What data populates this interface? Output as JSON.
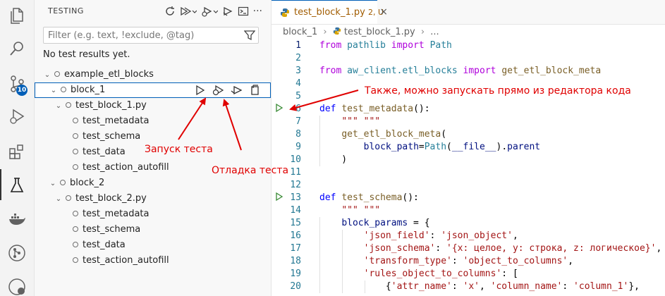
{
  "sidebar": {
    "title": "TESTING",
    "filter_placeholder": "Filter (e.g. text, !exclude, @tag)",
    "no_results": "No test results yet.",
    "tree": [
      {
        "label": "example_etl_blocks",
        "chev": "⌄"
      },
      {
        "label": "block_1",
        "chev": "⌄"
      },
      {
        "label": "test_block_1.py",
        "chev": "⌄"
      },
      {
        "label": "test_metadata",
        "chev": ""
      },
      {
        "label": "test_schema",
        "chev": ""
      },
      {
        "label": "test_data",
        "chev": ""
      },
      {
        "label": "test_action_autofill",
        "chev": ""
      },
      {
        "label": "block_2",
        "chev": "⌄"
      },
      {
        "label": "test_block_2.py",
        "chev": "⌄"
      },
      {
        "label": "test_metadata",
        "chev": ""
      },
      {
        "label": "test_schema",
        "chev": ""
      },
      {
        "label": "test_data",
        "chev": ""
      },
      {
        "label": "test_action_autofill",
        "chev": ""
      }
    ],
    "more_label": "···"
  },
  "activity": {
    "badge": "10",
    "icons": [
      "files-icon",
      "search-icon",
      "source-control-icon",
      "run-debug-icon",
      "extensions-icon",
      "testing-icon",
      "docker-icon",
      "git-graph-icon",
      "remote-icon"
    ]
  },
  "editor": {
    "tab_label": "test_block_1.py",
    "tab_status": "2, U",
    "breadcrumb": [
      "block_1",
      "test_block_1.py",
      "..."
    ],
    "lines": [
      {
        "n": "1",
        "segs": [
          [
            "kw2",
            "from"
          ],
          [
            "pl",
            " "
          ],
          [
            "cls",
            "pathlib"
          ],
          [
            "pl",
            " "
          ],
          [
            "kw2",
            "import"
          ],
          [
            "pl",
            " "
          ],
          [
            "cls",
            "Path"
          ]
        ]
      },
      {
        "n": "2",
        "segs": []
      },
      {
        "n": "3",
        "segs": [
          [
            "kw2",
            "from"
          ],
          [
            "pl",
            " "
          ],
          [
            "cls",
            "aw_client.etl_blocks"
          ],
          [
            "pl",
            " "
          ],
          [
            "kw2",
            "import"
          ],
          [
            "pl",
            " "
          ],
          [
            "fn",
            "get_etl_block_meta"
          ]
        ]
      },
      {
        "n": "4",
        "segs": []
      },
      {
        "n": "5",
        "segs": []
      },
      {
        "n": "6",
        "segs": [
          [
            "kw",
            "def"
          ],
          [
            "pl",
            " "
          ],
          [
            "fn",
            "test_metadata"
          ],
          [
            "pl",
            "():"
          ]
        ]
      },
      {
        "n": "7",
        "segs": [
          [
            "pl",
            "    "
          ],
          [
            "str",
            "\"\"\" \"\"\""
          ]
        ]
      },
      {
        "n": "8",
        "segs": [
          [
            "pl",
            "    "
          ],
          [
            "fn",
            "get_etl_block_meta"
          ],
          [
            "pl",
            "("
          ]
        ]
      },
      {
        "n": "9",
        "segs": [
          [
            "pl",
            "        "
          ],
          [
            "var",
            "block_path"
          ],
          [
            "pl",
            "="
          ],
          [
            "cls",
            "Path"
          ],
          [
            "pl",
            "("
          ],
          [
            "var",
            "__file__"
          ],
          [
            "pl",
            ")."
          ],
          [
            "var",
            "parent"
          ]
        ]
      },
      {
        "n": "10",
        "segs": [
          [
            "pl",
            "    )"
          ]
        ]
      },
      {
        "n": "11",
        "segs": []
      },
      {
        "n": "12",
        "segs": []
      },
      {
        "n": "13",
        "segs": [
          [
            "kw",
            "def"
          ],
          [
            "pl",
            " "
          ],
          [
            "fn",
            "test_schema"
          ],
          [
            "pl",
            "():"
          ]
        ]
      },
      {
        "n": "14",
        "segs": [
          [
            "pl",
            "    "
          ],
          [
            "str",
            "\"\"\" \"\"\""
          ]
        ]
      },
      {
        "n": "15",
        "segs": [
          [
            "pl",
            "    "
          ],
          [
            "var",
            "block_params"
          ],
          [
            "pl",
            " = {"
          ]
        ]
      },
      {
        "n": "16",
        "segs": [
          [
            "pl",
            "        "
          ],
          [
            "str",
            "'json_field'"
          ],
          [
            "pl",
            ": "
          ],
          [
            "str",
            "'json_object'"
          ],
          [
            "pl",
            ","
          ]
        ]
      },
      {
        "n": "17",
        "segs": [
          [
            "pl",
            "        "
          ],
          [
            "str",
            "'json_schema'"
          ],
          [
            "pl",
            ": "
          ],
          [
            "str",
            "'{x: целое, y: строка, z: логическое}'"
          ],
          [
            "pl",
            ","
          ]
        ]
      },
      {
        "n": "18",
        "segs": [
          [
            "pl",
            "        "
          ],
          [
            "str",
            "'transform_type'"
          ],
          [
            "pl",
            ": "
          ],
          [
            "str",
            "'object_to_columns'"
          ],
          [
            "pl",
            ","
          ]
        ]
      },
      {
        "n": "19",
        "segs": [
          [
            "pl",
            "        "
          ],
          [
            "str",
            "'rules_object_to_columns'"
          ],
          [
            "pl",
            ": ["
          ]
        ]
      },
      {
        "n": "20",
        "segs": [
          [
            "pl",
            "            {"
          ],
          [
            "str",
            "'attr_name'"
          ],
          [
            "pl",
            ": "
          ],
          [
            "str",
            "'x'"
          ],
          [
            "pl",
            ", "
          ],
          [
            "str",
            "'column_name'"
          ],
          [
            "pl",
            ": "
          ],
          [
            "str",
            "'column_1'"
          ],
          [
            "pl",
            "},"
          ]
        ]
      }
    ]
  },
  "annotations": {
    "editor_note": "Также, можно запускать прямо из редактора кода",
    "run_note": "Запуск теста",
    "debug_note": "Отладка теста"
  },
  "colors": {
    "annotation": "#e00000",
    "accent": "#005fb8"
  }
}
